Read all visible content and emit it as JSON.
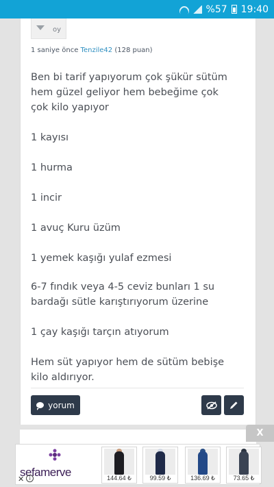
{
  "status_bar": {
    "battery": "%57",
    "time": "19:40",
    "bg_color": "#12a3d6"
  },
  "vote": {
    "down_label": "oy"
  },
  "meta": {
    "time_ago": "1 saniye önce",
    "username": "Tenzile42",
    "points": "(128 puan)"
  },
  "post": {
    "paragraphs": [
      "Ben bi tarif yapıyorum çok şükür sütüm hem güzel geliyor hem bebeğime çok çok kilo yapıyor",
      "1 kayısı",
      "1 hurma",
      "1 incir",
      "1 avuç Kuru üzüm",
      "1 yemek kaşığı yulaf ezmesi",
      "6-7 fındık veya 4-5 ceviz bunları 1 su bardağı sütle karıştırıyorum üzerine",
      "1 çay kaşığı tarçın atıyorum",
      "Hem süt yapıyor hem de sütüm bebişe kilo aldırıyor."
    ]
  },
  "actions": {
    "comment_label": "yorum",
    "button_color": "#2e3a4a"
  },
  "ad": {
    "close_label": "X",
    "brand": "sefamerve",
    "products": [
      {
        "price": "144.64 ₺"
      },
      {
        "price": "99.59 ₺"
      },
      {
        "price": "136.69 ₺"
      },
      {
        "price": "73.65 ₺"
      }
    ]
  }
}
